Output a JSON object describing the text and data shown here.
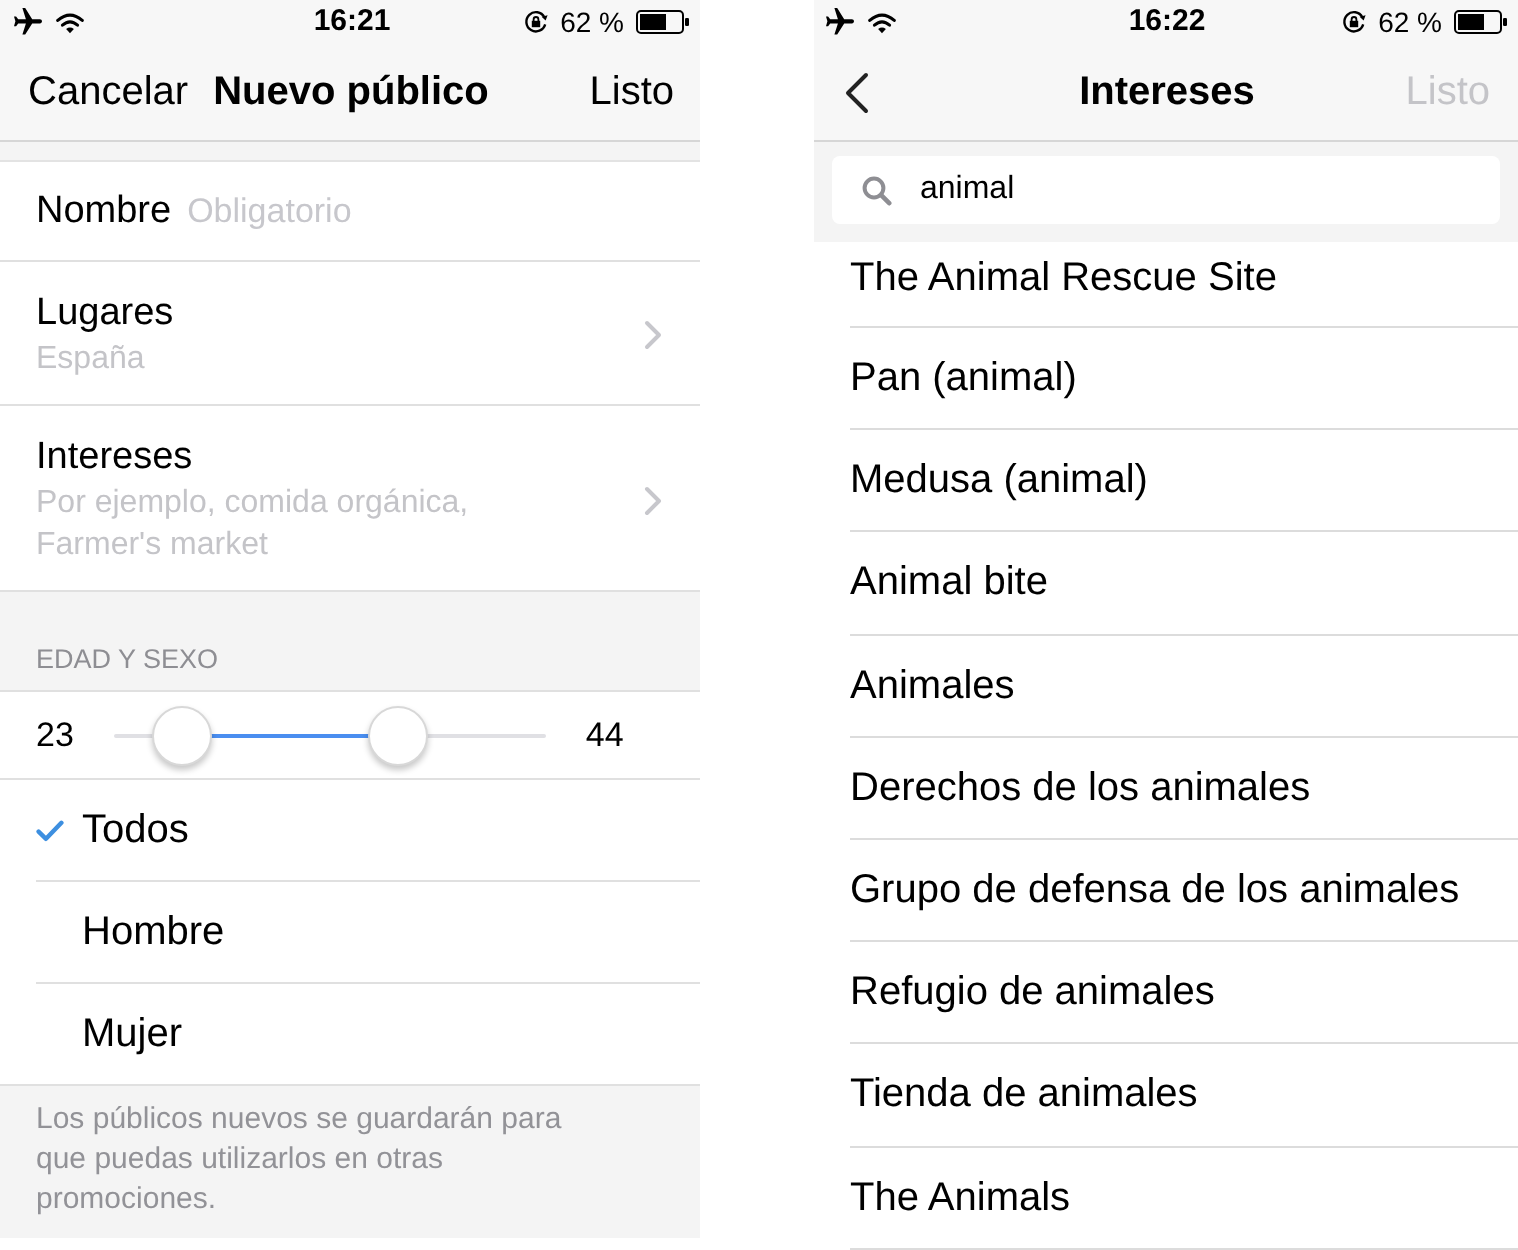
{
  "new_audience_screen": {
    "status_bar": {
      "time": "16:21",
      "battery": "62 %"
    },
    "nav_bar": {
      "cancel": "Cancelar",
      "title": "Nuevo público",
      "done": {
        "label": "Listo",
        "disabled": false
      }
    },
    "name_field": {
      "label": "Nombre",
      "placeholder": "Obligatorio"
    },
    "rows": [
      {
        "title": "Lugares",
        "subtitle": "España"
      },
      {
        "title": "Intereses",
        "subtitle": "Por ejemplo, comida orgánica, Farmer's market"
      }
    ],
    "age_gender": {
      "header": "EDAD Y SEXO",
      "min_age": "23",
      "max_age": "44",
      "handles": [
        {
          "level": 0.16
        },
        {
          "level": 0.66
        }
      ],
      "options": [
        {
          "label": "Todos",
          "selected": true
        },
        {
          "label": "Hombre",
          "selected": false
        },
        {
          "label": "Mujer",
          "selected": false
        }
      ]
    },
    "footer": "Los públicos nuevos se guardarán para que puedas utilizarlos en otras promociones."
  },
  "interests_screen": {
    "status_bar": {
      "time": "16:22",
      "battery": "62 %"
    },
    "nav_bar": {
      "title": "Intereses",
      "done": {
        "label": "Listo",
        "disabled": true
      }
    },
    "search": {
      "value": "animal"
    },
    "results": [
      "The Animal Rescue Site",
      "Pan (animal)",
      "Medusa (animal)",
      "Animal bite",
      "Animales",
      "Derechos de los animales",
      "Grupo de defensa de los animales",
      "Refugio de animales",
      "Tienda de animales",
      "The Animals"
    ]
  }
}
